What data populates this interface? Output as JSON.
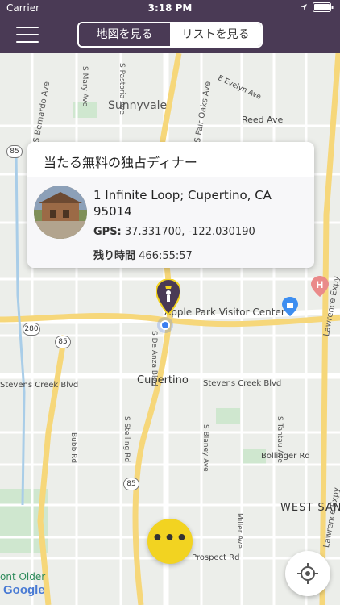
{
  "status_bar": {
    "carrier": "Carrier",
    "time": "3:18 PM"
  },
  "nav": {
    "segment_map": "地図を見る",
    "segment_list": "リストを見る"
  },
  "map": {
    "labels": {
      "sunnyvale": "Sunnyvale",
      "cupertino": "Cupertino",
      "west_san": "WEST SAN",
      "reed_ave": "Reed Ave",
      "e_evelyn": "E Evelyn Ave",
      "stevens_creek_left": "Stevens Creek Blvd",
      "stevens_creek_right": "Stevens Creek Blvd",
      "bollinger": "Bollinger Rd",
      "prospect": "Prospect Rd",
      "bubb": "Bubb Rd",
      "lawrence1": "Lawrence Expy",
      "lawrence2": "Lawrence Expy",
      "de_anza": "S De Anza Blvd",
      "stelling": "S Stelling Rd",
      "blaney": "S Blaney Ave",
      "tantau": "S Tantau Ave",
      "miller": "Miller Ave",
      "s_mary": "S Mary Ave",
      "s_bernardo": "S Bernardo Ave",
      "s_pastoria": "S Pastoria Ave",
      "s_fair_oaks": "S Fair Oaks Ave",
      "visitor_center": "Apple Park Visitor Center",
      "font_older": "ont Older"
    },
    "highways": [
      "85",
      "280",
      "85",
      "85"
    ],
    "google": "Google"
  },
  "card": {
    "title": "当たる無料の独占ディナー",
    "address": " 1 Infinite Loop; Cupertino, CA 95014",
    "gps_label": "GPS:",
    "gps_value": "37.331700, -122.030190",
    "remaining_label": "残り時間",
    "remaining_value": "466:55:57"
  },
  "buttons": {
    "more": "•••"
  },
  "colors": {
    "nav_bg": "#4a3a55",
    "accent_yellow": "#f2d321",
    "user_blue": "#3b7ef0"
  }
}
